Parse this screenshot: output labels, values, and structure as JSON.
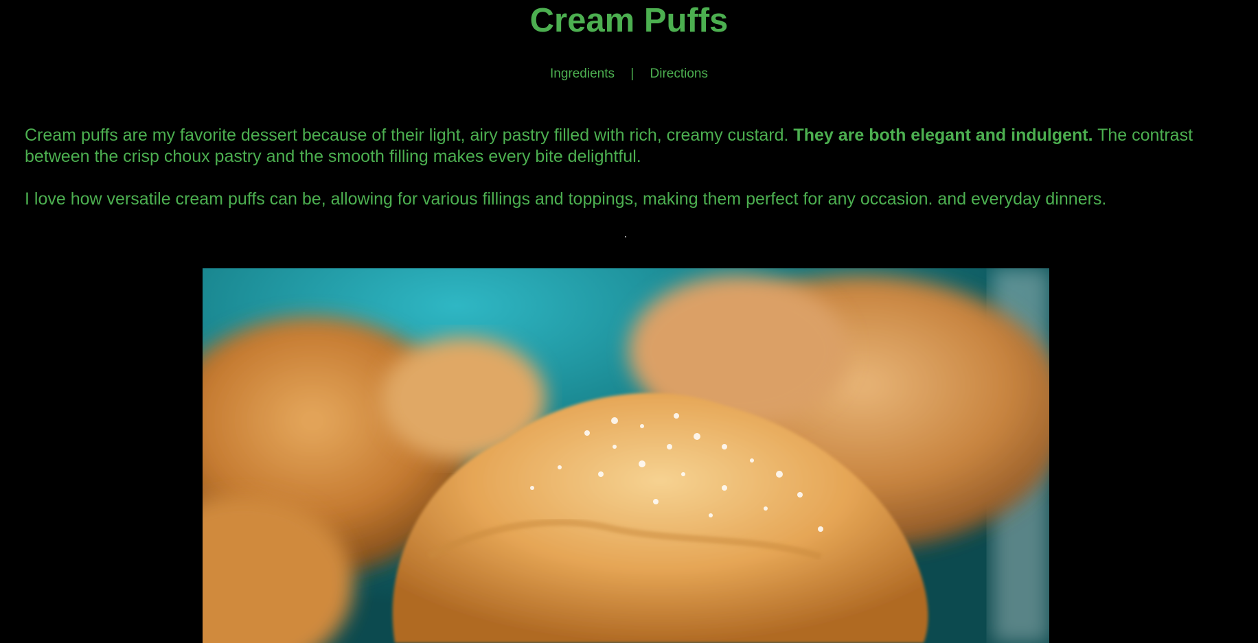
{
  "page": {
    "title": "Cream Puffs"
  },
  "nav": {
    "ingredients_label": "Ingredients",
    "separator": "|",
    "directions_label": "Directions"
  },
  "content": {
    "intro_part1": "Cream puffs are my favorite dessert because of their light, airy pastry filled with rich, creamy custard. ",
    "intro_bold": "They are both elegant and indulgent.",
    "intro_part2": " The contrast between the crisp choux pastry and the smooth filling makes every bite delightful.",
    "love_text": "I love how versatile cream puffs can be, allowing for various fillings and toppings, making them perfect for any occasion. and everyday dinners."
  },
  "colors": {
    "background": "#000000",
    "text_green": "#4caf50"
  },
  "photo": {
    "subject": "cream-puffs-photo"
  }
}
